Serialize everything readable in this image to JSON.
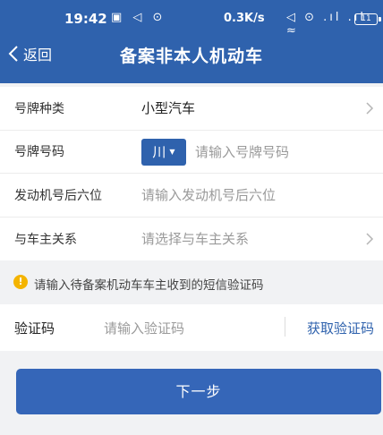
{
  "status_bar": {
    "time": "19:42",
    "left_icons": "▣ ◁ ⊙",
    "net_speed": "0.3K/s",
    "right_icons": "◁ ⊙ .ıl .ıl ≈",
    "battery": "11"
  },
  "nav": {
    "back_label": "返回",
    "title": "备案非本人机动车"
  },
  "form": {
    "plate_type": {
      "label": "号牌种类",
      "value": "小型汽车"
    },
    "plate_number": {
      "label": "号牌号码",
      "province": "川",
      "placeholder": "请输入号牌号码"
    },
    "engine": {
      "label": "发动机号后六位",
      "placeholder": "请输入发动机号后六位"
    },
    "relation": {
      "label": "与车主关系",
      "placeholder": "请选择与车主关系"
    }
  },
  "notice": {
    "icon": "!",
    "text": "请输入待备案机动车车主收到的短信验证码"
  },
  "verify": {
    "label": "验证码",
    "placeholder": "请输入验证码",
    "action": "获取验证码"
  },
  "next_button": "下一步",
  "colors": {
    "primary": "#2f62ad",
    "warning": "#f4b400"
  }
}
